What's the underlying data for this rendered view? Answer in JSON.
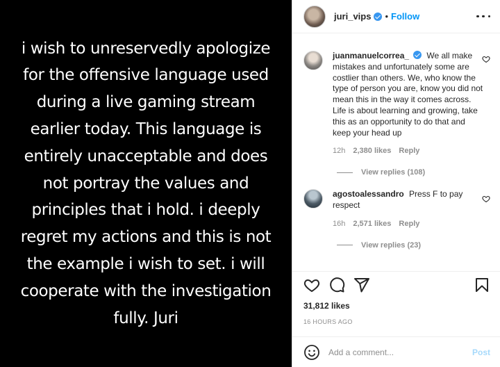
{
  "post": {
    "statement": "i wish to unreservedly apologize\nfor the offensive language used\nduring a live gaming stream\nearlier today. This language is\nentirely unacceptable and does\nnot portray the values and\nprinciples that i hold. i deeply\nregret my actions and this is not\nthe example i wish to set. i will\ncooperate with the investigation\nfully. Juri"
  },
  "header": {
    "username": "juri_vips",
    "separator": "•",
    "follow_label": "Follow"
  },
  "comments": [
    {
      "username": "juanmanuelcorrea_",
      "text": "We all make mistakes and unfortunately some are costlier than others. We, who know the type of person you are, know you did not mean this in the way it comes across. Life is about learning and growing, take this as an opportunity to do that and keep your head up",
      "time": "12h",
      "likes": "2,380 likes",
      "reply_label": "Reply",
      "view_replies": "View replies (108)"
    },
    {
      "username": "agostoalessandro",
      "text": "Press F to pay respect",
      "time": "16h",
      "likes": "2,571 likes",
      "reply_label": "Reply",
      "view_replies": "View replies (23)"
    }
  ],
  "stats": {
    "likes": "31,812 likes",
    "time_ago": "16 HOURS AGO"
  },
  "add_comment": {
    "placeholder": "Add a comment...",
    "post_label": "Post"
  },
  "colors": {
    "accent": "#0095f6",
    "verified": "#3897f0",
    "muted": "#8e8e8e",
    "text": "#262626"
  },
  "icons": [
    "more-icon",
    "verified-icon",
    "heart-icon",
    "comment-icon",
    "share-icon",
    "save-icon",
    "emoji-icon"
  ]
}
